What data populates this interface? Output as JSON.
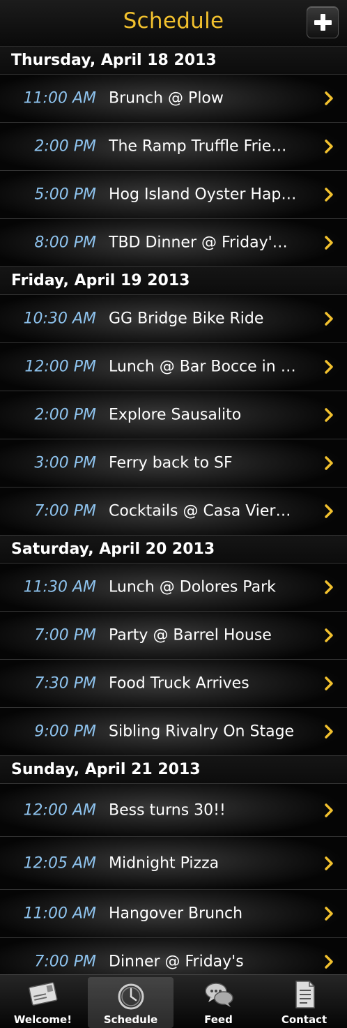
{
  "navbar": {
    "title": "Schedule"
  },
  "days": [
    {
      "label": "Thursday, April 18 2013",
      "events": [
        {
          "time": "11:00 AM",
          "title": "Brunch @ Plow"
        },
        {
          "time": "2:00 PM",
          "title": "The Ramp Truffle Frie…"
        },
        {
          "time": "5:00 PM",
          "title": "Hog Island Oyster Hap…"
        },
        {
          "time": "8:00 PM",
          "title": "TBD Dinner @ Friday'…"
        }
      ]
    },
    {
      "label": "Friday, April 19 2013",
      "events": [
        {
          "time": "10:30 AM",
          "title": "GG Bridge Bike Ride"
        },
        {
          "time": "12:00 PM",
          "title": "Lunch @ Bar Bocce in …"
        },
        {
          "time": "2:00 PM",
          "title": "Explore Sausalito"
        },
        {
          "time": "3:00 PM",
          "title": "Ferry back to SF"
        },
        {
          "time": "7:00 PM",
          "title": "Cocktails @ Casa Vier…"
        }
      ]
    },
    {
      "label": "Saturday, April 20 2013",
      "events": [
        {
          "time": "11:30 AM",
          "title": "Lunch @ Dolores Park"
        },
        {
          "time": "7:00 PM",
          "title": "Party @ Barrel House"
        },
        {
          "time": "7:30 PM",
          "title": "Food Truck Arrives"
        },
        {
          "time": "9:00 PM",
          "title": "Sibling Rivalry On Stage"
        }
      ]
    },
    {
      "label": "Sunday, April 21 2013",
      "events": [
        {
          "time": "12:00 AM",
          "title": "Bess turns 30!!"
        },
        {
          "time": "12:05 AM",
          "title": "Midnight Pizza"
        },
        {
          "time": "11:00 AM",
          "title": "Hangover Brunch"
        },
        {
          "time": "7:00 PM",
          "title": "Dinner @ Friday's"
        }
      ]
    }
  ],
  "tabs": [
    {
      "label": "Welcome!",
      "icon": "postcard-icon",
      "selected": false
    },
    {
      "label": "Schedule",
      "icon": "clock-icon",
      "selected": true
    },
    {
      "label": "Feed",
      "icon": "chat-bubbles-icon",
      "selected": false
    },
    {
      "label": "Contact",
      "icon": "document-icon",
      "selected": false
    }
  ],
  "colors": {
    "accent": "#f2c12e",
    "time": "#8ec3ee",
    "background": "#000000"
  }
}
